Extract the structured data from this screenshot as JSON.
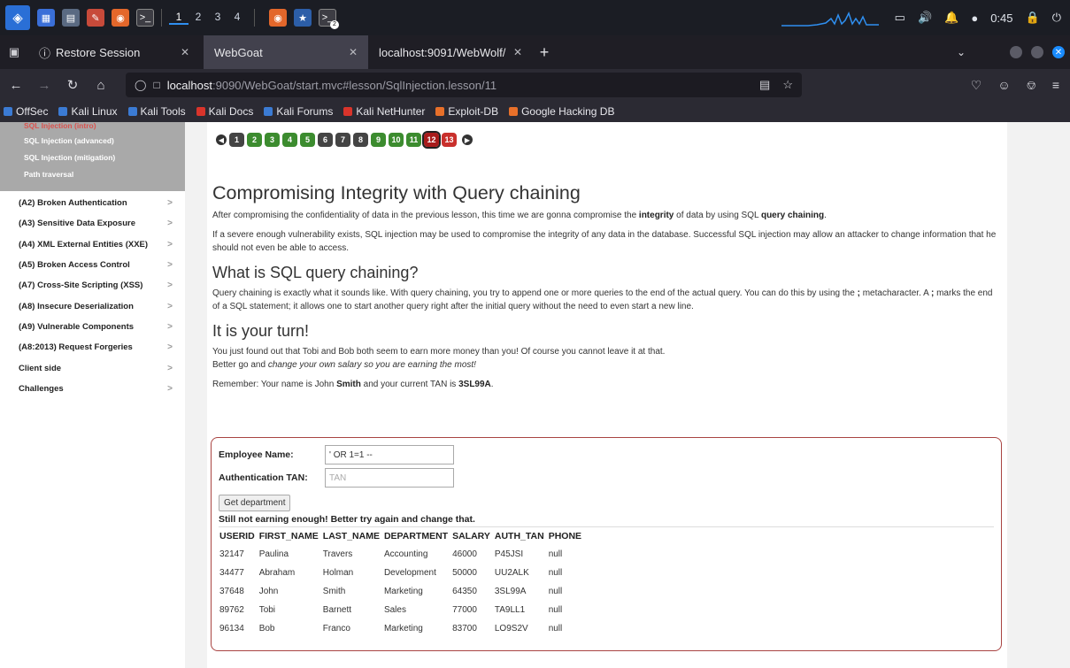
{
  "taskbar": {
    "workspaces": [
      "1",
      "2",
      "3",
      "4"
    ],
    "active_workspace": "1",
    "clock": "0:45",
    "terminal_badge": "2"
  },
  "tabs": [
    {
      "label": "Restore Session",
      "active": false
    },
    {
      "label": "WebGoat",
      "active": true
    },
    {
      "label": "localhost:9091/WebWolf/ho",
      "active": false
    }
  ],
  "navbar": {
    "url_host": "localhost",
    "url_rest": ":9090/WebGoat/start.mvc#lesson/SqlInjection.lesson/11"
  },
  "bookmarks": [
    {
      "label": "OffSec",
      "color": "#3b7bd4"
    },
    {
      "label": "Kali Linux",
      "color": "#3b7bd4"
    },
    {
      "label": "Kali Tools",
      "color": "#3b7bd4"
    },
    {
      "label": "Kali Docs",
      "color": "#d9342b"
    },
    {
      "label": "Kali Forums",
      "color": "#3b7bd4"
    },
    {
      "label": "Kali NetHunter",
      "color": "#d9342b"
    },
    {
      "label": "Exploit-DB",
      "color": "#e8702a"
    },
    {
      "label": "Google Hacking DB",
      "color": "#e8702a"
    }
  ],
  "sidebar": {
    "sub_items": [
      {
        "label": "SQL Injection (intro)",
        "current": true
      },
      {
        "label": "SQL Injection (advanced)",
        "current": false
      },
      {
        "label": "SQL Injection (mitigation)",
        "current": false
      },
      {
        "label": "Path traversal",
        "current": false
      }
    ],
    "categories": [
      "(A2) Broken Authentication",
      "(A3) Sensitive Data Exposure",
      "(A4) XML External Entities (XXE)",
      "(A5) Broken Access Control",
      "(A7) Cross-Site Scripting (XSS)",
      "(A8) Insecure Deserialization",
      "(A9) Vulnerable Components",
      "(A8:2013) Request Forgeries",
      "Client side",
      "Challenges"
    ],
    "chevron": ">"
  },
  "lesson_nav": {
    "pages": [
      {
        "n": "1",
        "state": "todo"
      },
      {
        "n": "2",
        "state": "done"
      },
      {
        "n": "3",
        "state": "done"
      },
      {
        "n": "4",
        "state": "done"
      },
      {
        "n": "5",
        "state": "done"
      },
      {
        "n": "6",
        "state": "todo"
      },
      {
        "n": "7",
        "state": "todo"
      },
      {
        "n": "8",
        "state": "todo"
      },
      {
        "n": "9",
        "state": "done"
      },
      {
        "n": "10",
        "state": "done"
      },
      {
        "n": "11",
        "state": "done"
      },
      {
        "n": "12",
        "state": "cur"
      },
      {
        "n": "13",
        "state": "err"
      }
    ]
  },
  "content": {
    "title": "Compromising Integrity with Query chaining",
    "p1_pre": "After compromising the confidentiality of data in the previous lesson, this time we are gonna compromise the ",
    "p1_b1": "integrity",
    "p1_mid": " of data by using SQL ",
    "p1_b2": "query chaining",
    "p1_post": ".",
    "p2": "If a severe enough vulnerability exists, SQL injection may be used to compromise the integrity of any data in the database. Successful SQL injection may allow an attacker to change information that he should not even be able to access.",
    "h_what": "What is SQL query chaining?",
    "p3_pre": "Query chaining is exactly what it sounds like. With query chaining, you try to append one or more queries to the end of the actual query. You can do this by using the ",
    "p3_b1": ";",
    "p3_mid": " metacharacter. A ",
    "p3_b2": ";",
    "p3_post": " marks the end of a SQL statement; it allows one to start another query right after the initial query without the need to even start a new line.",
    "h_turn": "It is your turn!",
    "p4_line1": "You just found out that Tobi and Bob both seem to earn more money than you! Of course you cannot leave it at that.",
    "p4_line2_pre": "Better go and ",
    "p4_line2_em": "change your own salary so you are earning the most!",
    "p5_pre": "Remember: Your name is John ",
    "p5_b1": "Smith",
    "p5_mid": " and your current TAN is ",
    "p5_b2": "3SL99A",
    "p5_post": "."
  },
  "form": {
    "name_label": "Employee Name:",
    "name_value": "' OR 1=1 --",
    "tan_label": "Authentication TAN:",
    "tan_placeholder": "TAN",
    "submit_label": "Get department",
    "feedback": "Still not earning enough! Better try again and change that."
  },
  "results": {
    "columns": [
      "USERID",
      "FIRST_NAME",
      "LAST_NAME",
      "DEPARTMENT",
      "SALARY",
      "AUTH_TAN",
      "PHONE"
    ],
    "rows": [
      [
        "32147",
        "Paulina",
        "Travers",
        "Accounting",
        "46000",
        "P45JSI",
        "null"
      ],
      [
        "34477",
        "Abraham",
        "Holman",
        "Development",
        "50000",
        "UU2ALK",
        "null"
      ],
      [
        "37648",
        "John",
        "Smith",
        "Marketing",
        "64350",
        "3SL99A",
        "null"
      ],
      [
        "89762",
        "Tobi",
        "Barnett",
        "Sales",
        "77000",
        "TA9LL1",
        "null"
      ],
      [
        "96134",
        "Bob",
        "Franco",
        "Marketing",
        "83700",
        "LO9S2V",
        "null"
      ]
    ]
  }
}
